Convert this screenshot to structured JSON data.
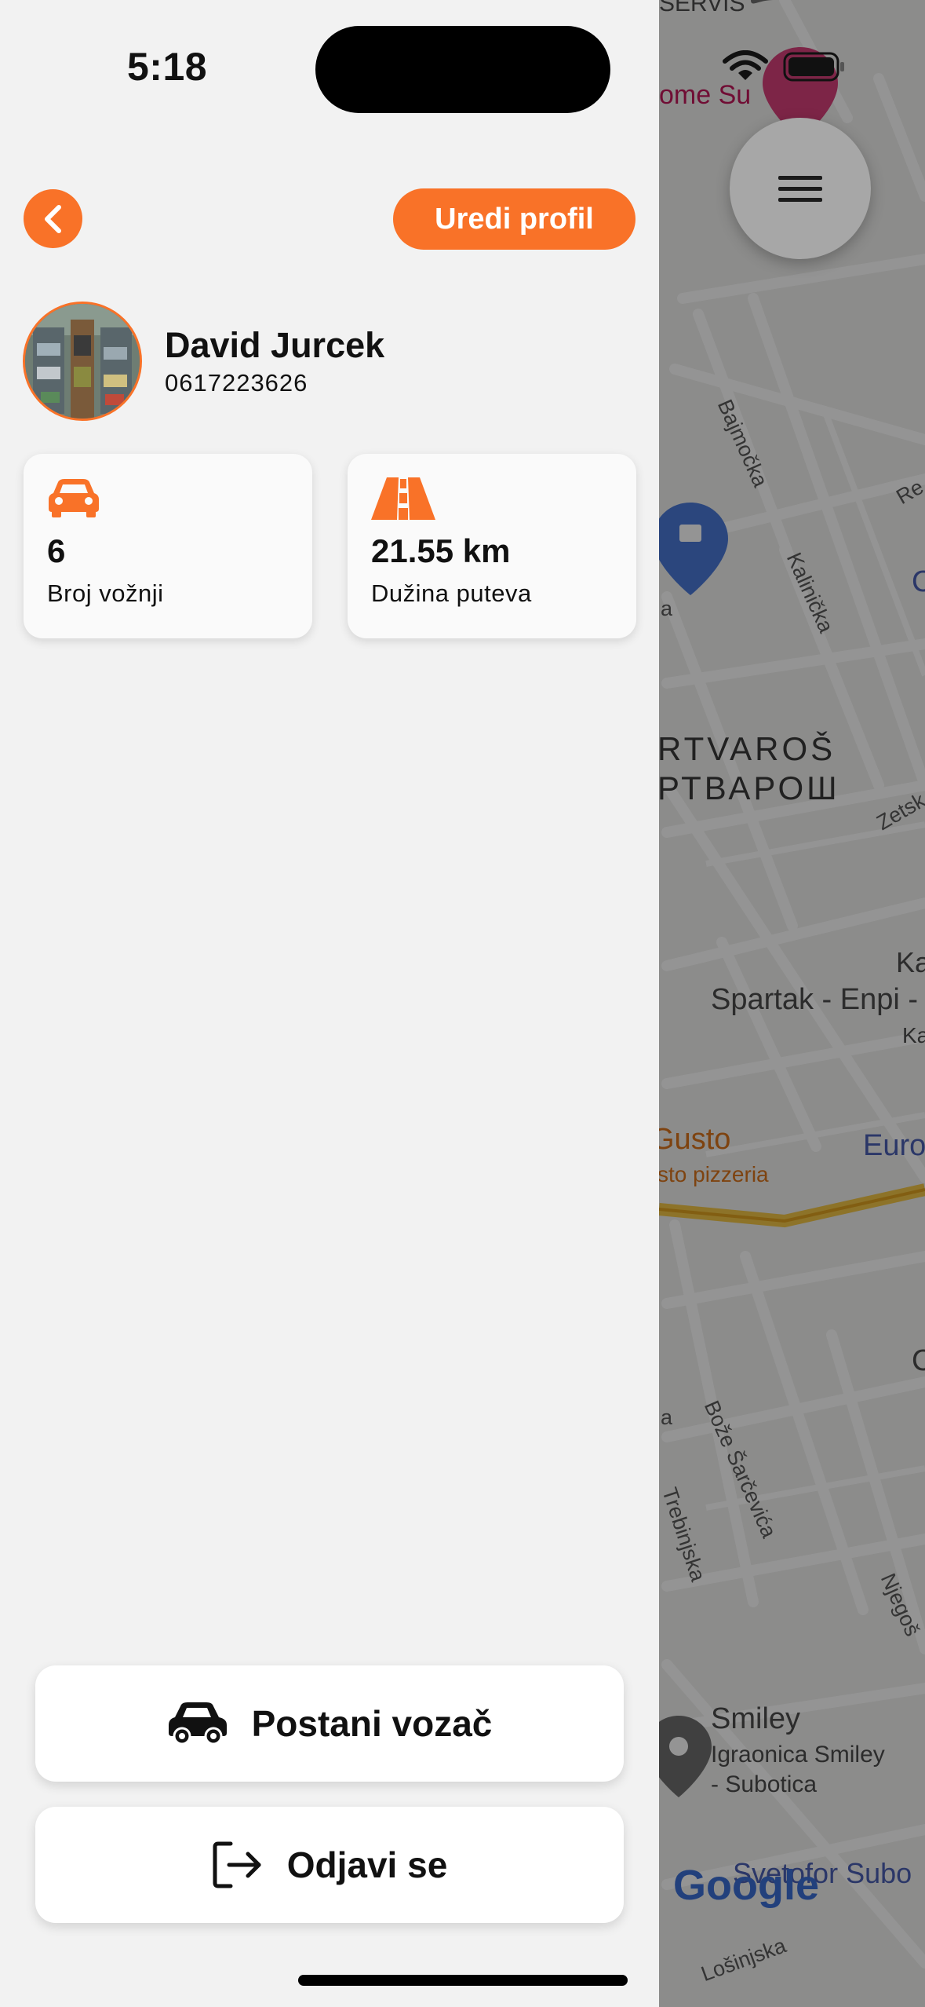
{
  "status_bar": {
    "time": "5:18"
  },
  "header": {
    "back_icon": "chevron-left-icon",
    "edit_profile_label": "Uredi profil"
  },
  "user": {
    "name": "David Jurcek",
    "phone": "0617223626"
  },
  "stats": [
    {
      "icon": "car-icon",
      "value": "6",
      "label": "Broj vožnji"
    },
    {
      "icon": "road-icon",
      "value": "21.55 km",
      "label": "Dužina puteva"
    }
  ],
  "actions": {
    "become_driver_label": "Postani vozač",
    "logout_label": "Odjavi se"
  },
  "map": {
    "labels": {
      "servis": "SERVIS",
      "home": "ome Su",
      "district_latin": "RTVAROŠ",
      "district_cyrillic": "РТВАРОШ",
      "spartak": "Spartak - Enpi -",
      "ka1": "Ka",
      "ka2": "Ka",
      "gusto": "Gusto",
      "gusto_sub": "sto pizzeria",
      "euro": "Euro",
      "smiley": "Smiley",
      "smiley_sub1": "Igraonica Smiley",
      "smiley_sub2": "- Subotica",
      "svetofor": "Svetofor Subo",
      "google": "Google"
    },
    "streets": {
      "bajmocka": "Bajmočka",
      "kalinicka": "Kalinička",
      "zetska": "Zetsk",
      "boze": "Bože Šarčevića",
      "trebinjska": "Trebinjska",
      "njegos": "Njegoš",
      "losinjska": "Lošinjska",
      "re": "Re",
      "a1": "a",
      "a2": "a",
      "c1": "C",
      "c2": "C"
    }
  }
}
